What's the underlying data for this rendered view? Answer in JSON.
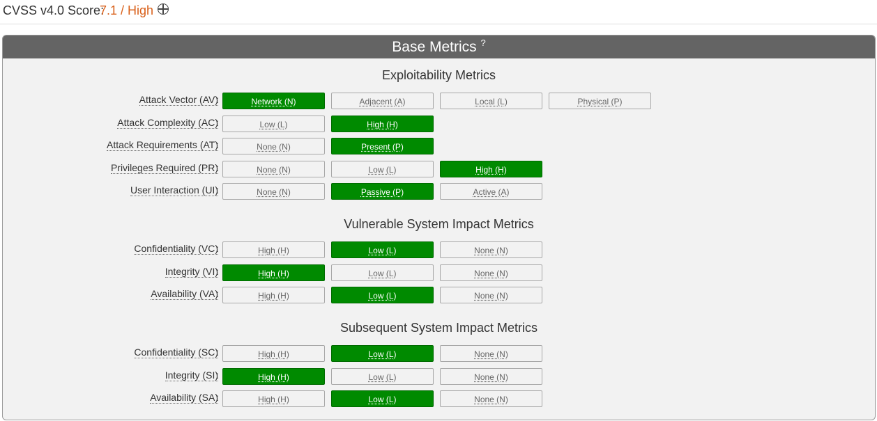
{
  "score": {
    "label": "CVSS v4.0 Score:",
    "value": "7.1 / High"
  },
  "panel": {
    "title": "Base Metrics",
    "help": "?"
  },
  "sections": [
    {
      "title": "Exploitability Metrics",
      "rows": [
        {
          "label": "Attack Vector (AV)",
          "options": [
            "Network (N)",
            "Adjacent (A)",
            "Local (L)",
            "Physical (P)"
          ],
          "selected": 0
        },
        {
          "label": "Attack Complexity (AC)",
          "options": [
            "Low (L)",
            "High (H)"
          ],
          "selected": 1
        },
        {
          "label": "Attack Requirements (AT)",
          "options": [
            "None (N)",
            "Present (P)"
          ],
          "selected": 1
        },
        {
          "label": "Privileges Required (PR)",
          "options": [
            "None (N)",
            "Low (L)",
            "High (H)"
          ],
          "selected": 2
        },
        {
          "label": "User Interaction (UI)",
          "options": [
            "None (N)",
            "Passive (P)",
            "Active (A)"
          ],
          "selected": 1
        }
      ]
    },
    {
      "title": "Vulnerable System Impact Metrics",
      "rows": [
        {
          "label": "Confidentiality (VC)",
          "options": [
            "High (H)",
            "Low (L)",
            "None (N)"
          ],
          "selected": 1
        },
        {
          "label": "Integrity (VI)",
          "options": [
            "High (H)",
            "Low (L)",
            "None (N)"
          ],
          "selected": 0
        },
        {
          "label": "Availability (VA)",
          "options": [
            "High (H)",
            "Low (L)",
            "None (N)"
          ],
          "selected": 1
        }
      ]
    },
    {
      "title": "Subsequent System Impact Metrics",
      "rows": [
        {
          "label": "Confidentiality (SC)",
          "options": [
            "High (H)",
            "Low (L)",
            "None (N)"
          ],
          "selected": 1
        },
        {
          "label": "Integrity (SI)",
          "options": [
            "High (H)",
            "Low (L)",
            "None (N)"
          ],
          "selected": 0
        },
        {
          "label": "Availability (SA)",
          "options": [
            "High (H)",
            "Low (L)",
            "None (N)"
          ],
          "selected": 1
        }
      ]
    }
  ],
  "colors": {
    "selected": "#008a00",
    "score": "#d9601a",
    "header": "#646464"
  }
}
